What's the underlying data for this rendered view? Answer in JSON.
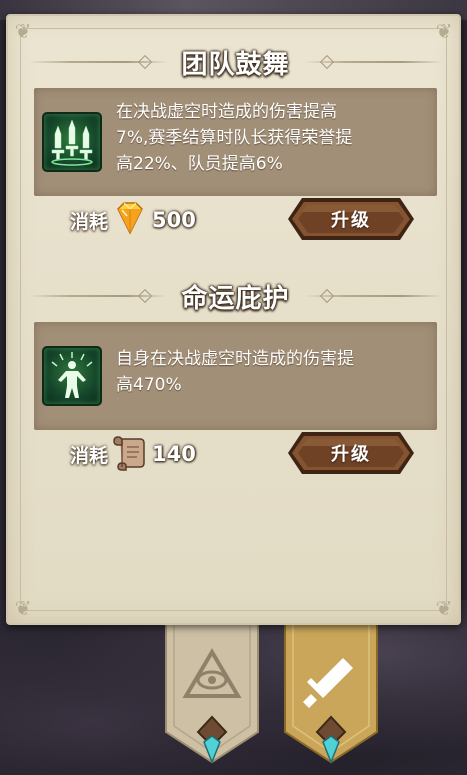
{
  "skills": [
    {
      "title": "团队鼓舞",
      "icon": "triple-sword-icon",
      "description": "在决战虚空时造成的伤害提高\n7%,赛季结算时队长获得荣誉提\n高22%、队员提高6%",
      "cost_label": "消耗",
      "cost_icon": "gem-icon",
      "cost_value": "500",
      "upgrade_label": "升级"
    },
    {
      "title": "命运庇护",
      "icon": "figure-radiance-icon",
      "description": "自身在决战虚空时造成的伤害提\n高470%",
      "cost_label": "消耗",
      "cost_icon": "scroll-icon",
      "cost_value": "140",
      "upgrade_label": "升级"
    }
  ],
  "tabs": [
    {
      "icon": "eye-pyramid-icon",
      "active": false
    },
    {
      "icon": "sword-icon",
      "active": true
    }
  ],
  "colors": {
    "panel": "#e6dfca",
    "desc_box": "#a28f78",
    "button": "#7a4a2c",
    "active_tab": "#c9a65a",
    "inactive_tab": "#ccbfa4"
  }
}
